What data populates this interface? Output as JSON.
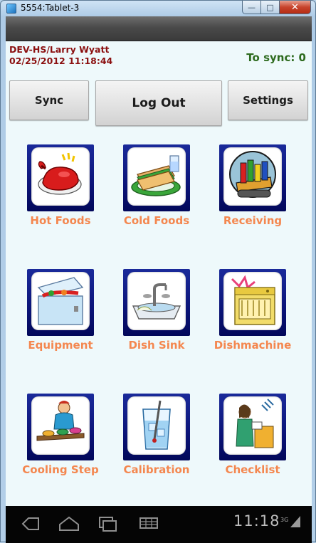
{
  "window": {
    "title": "5554:Tablet-3"
  },
  "header": {
    "user": "DEV-HS/Larry Wyatt",
    "datetime": "02/25/2012 11:18:44",
    "sync_status": "To sync: 0"
  },
  "actions": {
    "sync": "Sync",
    "logout": "Log Out",
    "settings": "Settings"
  },
  "tiles": [
    {
      "label": "Hot Foods",
      "icon": "roast-turkey-icon"
    },
    {
      "label": "Cold Foods",
      "icon": "sandwich-icon"
    },
    {
      "label": "Receiving",
      "icon": "delivery-cart-icon"
    },
    {
      "label": "Equipment",
      "icon": "chest-freezer-icon"
    },
    {
      "label": "Dish Sink",
      "icon": "sink-icon"
    },
    {
      "label": "Dishmachine",
      "icon": "dishwasher-icon"
    },
    {
      "label": "Cooling Step",
      "icon": "chef-cooling-icon"
    },
    {
      "label": "Calibration",
      "icon": "ice-water-glass-icon"
    },
    {
      "label": "Checklist",
      "icon": "woman-checklist-icon"
    }
  ],
  "status_bar": {
    "time": "11:18",
    "network": "3G"
  },
  "colors": {
    "label": "#f4874f",
    "user_text": "#8b1010",
    "sync_text": "#2e6b1f",
    "tile_frame": "#0b1478",
    "app_bg": "#eef9fb"
  }
}
